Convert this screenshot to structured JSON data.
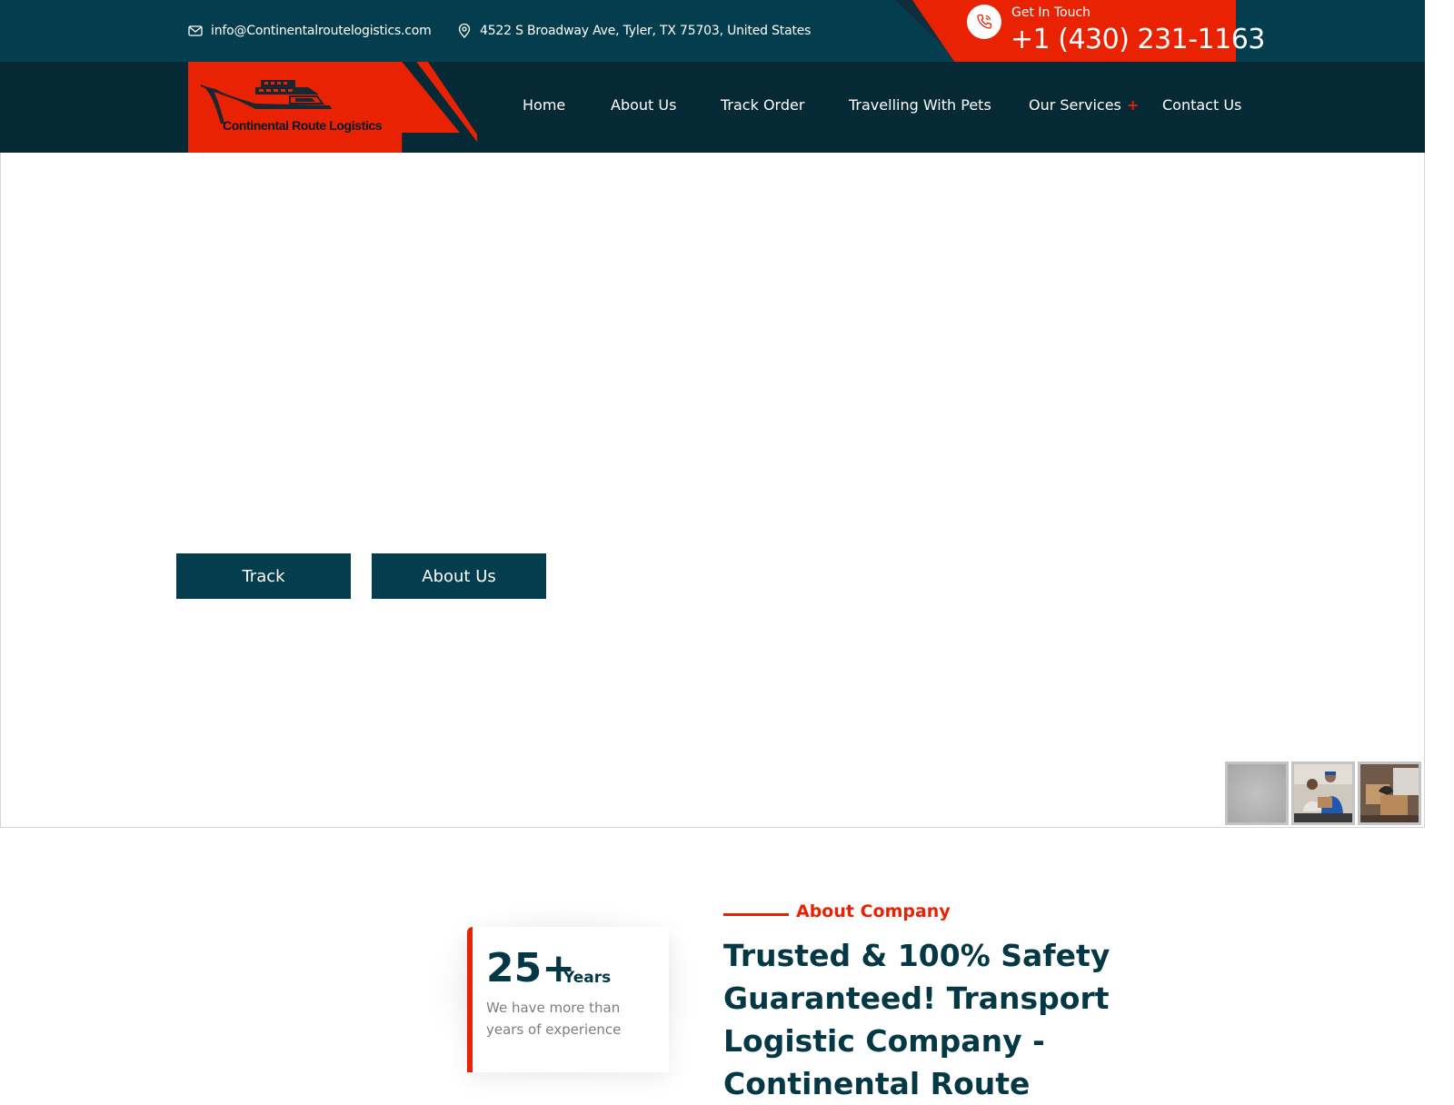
{
  "topbar": {
    "email": "info@Continentalroutelogistics.com",
    "address": "4522 S Broadway Ave, Tyler, TX 75703, United States",
    "contact_label": "Get In Touch",
    "phone": "+1 (430) 231-1163"
  },
  "brand": {
    "name": "Continental Route Logistics"
  },
  "nav": {
    "items": [
      {
        "label": "Home"
      },
      {
        "label": "About Us"
      },
      {
        "label": "Track Order"
      },
      {
        "label": "Travelling With Pets"
      },
      {
        "label": "Our Services"
      },
      {
        "label": "Contact Us"
      }
    ],
    "services_plus": "+"
  },
  "hero": {
    "buttons": [
      {
        "label": "Track"
      },
      {
        "label": "About Us"
      }
    ]
  },
  "about": {
    "section_label": "About Company",
    "experience_number": "25+",
    "experience_unit": "Years",
    "experience_desc": "We have more than years of experience",
    "heading": "Trusted & 100% Safety Guaranteed! Transport Logistic Company - Continental Route"
  },
  "colors": {
    "primary": "#043d4d",
    "nav_bg": "#052a36",
    "accent": "#e82203"
  },
  "icons": {
    "email": "envelope-icon",
    "address": "map-pin-icon",
    "phone": "phone-icon"
  }
}
